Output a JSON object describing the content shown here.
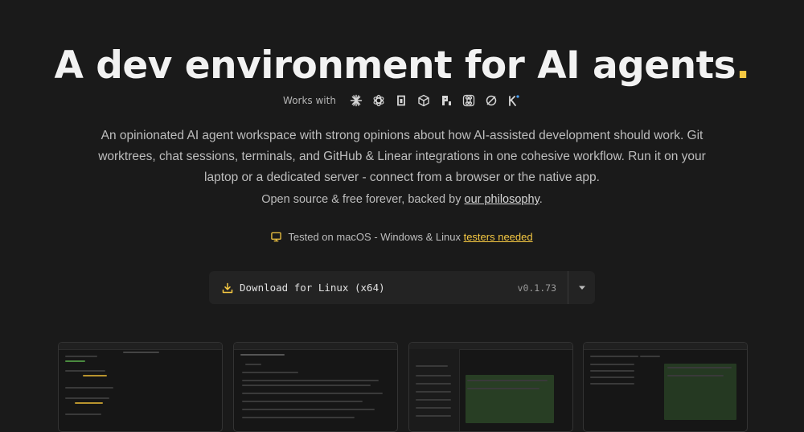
{
  "hero": {
    "title": "A dev environment for AI agents",
    "title_dot": "."
  },
  "works_with": {
    "label": "Works with",
    "icons": [
      "claude-icon",
      "openai-icon",
      "opencode-icon",
      "cube-icon",
      "pi-icon",
      "command-icon",
      "cursor-icon",
      "kilo-icon"
    ]
  },
  "description": "An opinionated AI agent workspace with strong opinions about how AI-assisted development should work. Git worktrees, chat sessions, terminals, and GitHub & Linear integrations in one cohesive workflow. Run it on your laptop or a dedicated server - connect from a browser or the native app.",
  "open_source": {
    "prefix": "Open source & free forever, backed by ",
    "link": "our philosophy",
    "suffix": "."
  },
  "tested": {
    "prefix": "Tested on macOS - Windows & Linux ",
    "link": "testers needed"
  },
  "download": {
    "label": "Download for Linux (x64)",
    "version": "v0.1.73"
  },
  "colors": {
    "background": "#1a1a1a",
    "accent": "#f5c842"
  }
}
